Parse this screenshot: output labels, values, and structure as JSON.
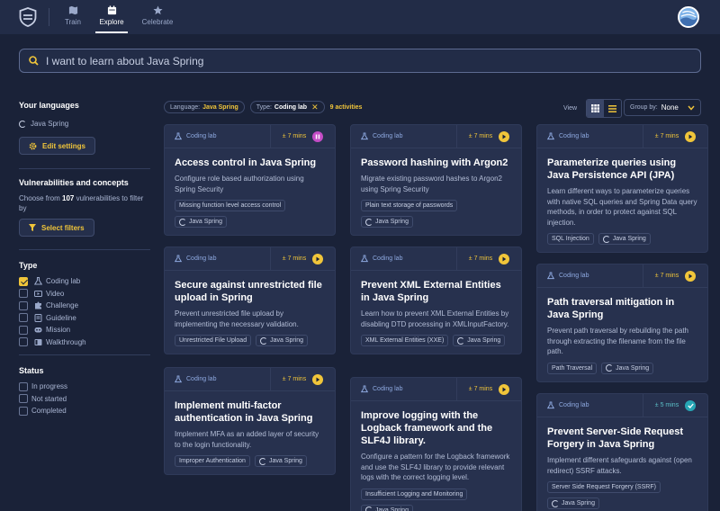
{
  "nav": {
    "items": [
      {
        "label": "Train",
        "icon": "map-icon"
      },
      {
        "label": "Explore",
        "icon": "calendar-icon",
        "active": true
      },
      {
        "label": "Celebrate",
        "icon": "star-icon"
      }
    ]
  },
  "search": {
    "placeholder": "I want to learn about Java Spring"
  },
  "sidebar": {
    "languages_title": "Your languages",
    "language": "Java Spring",
    "edit_settings": "Edit settings",
    "vuln_title": "Vulnerabilities and concepts",
    "vuln_text_before": "Choose from ",
    "vuln_count": "107",
    "vuln_text_after": " vulnerabilities to filter by",
    "select_filters": "Select filters",
    "type_title": "Type",
    "types": [
      {
        "label": "Coding lab",
        "checked": true,
        "icon": "flask-icon"
      },
      {
        "label": "Video",
        "checked": false,
        "icon": "video-icon"
      },
      {
        "label": "Challenge",
        "checked": false,
        "icon": "puzzle-icon"
      },
      {
        "label": "Guideline",
        "checked": false,
        "icon": "guideline-icon"
      },
      {
        "label": "Mission",
        "checked": false,
        "icon": "mission-icon"
      },
      {
        "label": "Walkthrough",
        "checked": false,
        "icon": "walkthrough-icon"
      }
    ],
    "status_title": "Status",
    "statuses": [
      {
        "label": "In progress",
        "checked": false
      },
      {
        "label": "Not started",
        "checked": false
      },
      {
        "label": "Completed",
        "checked": false
      }
    ]
  },
  "filters": {
    "language_prefix": "Language:",
    "language_value": "Java Spring",
    "type_prefix": "Type:",
    "type_value": "Coding lab",
    "activity_count": "9 activities"
  },
  "view": {
    "label": "View",
    "group_by_label": "Group by:",
    "group_by_value": "None"
  },
  "cards": [
    {
      "type": "Coding lab",
      "duration": "± 7 mins",
      "status": "pause",
      "title": "Access control in Java Spring",
      "desc": "Configure role based authorization using Spring Security",
      "tags": [
        "Missing function level access control",
        "Java Spring"
      ]
    },
    {
      "type": "Coding lab",
      "duration": "± 7 mins",
      "status": "play",
      "title": "Secure against unrestricted file upload in Spring",
      "desc": "Prevent unrestricted file upload by implementing the necessary validation.",
      "tags": [
        "Unrestricted File Upload",
        "Java Spring"
      ]
    },
    {
      "type": "Coding lab",
      "duration": "± 7 mins",
      "status": "play",
      "title": "Implement multi-factor authentication in Java Spring",
      "desc": "Implement MFA as an added layer of security to the login functionality.",
      "tags": [
        "Improper Authentication",
        "Java Spring"
      ]
    },
    {
      "type": "Coding lab",
      "duration": "± 7 mins",
      "status": "play",
      "title": "Password hashing with Argon2",
      "desc": "Migrate existing password hashes to Argon2 using Spring Security",
      "tags": [
        "Plain text storage of passwords",
        "Java Spring"
      ]
    },
    {
      "type": "Coding lab",
      "duration": "± 7 mins",
      "status": "play",
      "title": "Prevent XML External Entities in Java Spring",
      "desc": "Learn how to prevent XML External Entities by disabling DTD processing in XMLInputFactory.",
      "tags": [
        "XML External Entities (XXE)",
        "Java Spring"
      ]
    },
    {
      "type": "Coding lab",
      "duration": "± 7 mins",
      "status": "play",
      "title": "Improve logging with the Logback framework and the SLF4J library.",
      "desc": "Configure a pattern for the Logback framework and use the SLF4J library to provide relevant logs with the correct logging level.",
      "tags": [
        "Insufficient Logging and Monitoring",
        "Java Spring"
      ]
    },
    {
      "type": "Coding lab",
      "duration": "± 7 mins",
      "status": "play",
      "title": "Parameterize queries using Java Persistence API (JPA)",
      "desc": "Learn different ways to parameterize queries with native SQL queries and Spring Data query methods, in order to protect against SQL injection.",
      "tags": [
        "SQL Injection",
        "Java Spring"
      ]
    },
    {
      "type": "Coding lab",
      "duration": "± 7 mins",
      "status": "play",
      "title": "Path traversal mitigation in Java Spring",
      "desc": "Prevent path traversal by rebuilding the path through extracting the filename from the file path.",
      "tags": [
        "Path Traversal",
        "Java Spring"
      ]
    },
    {
      "type": "Coding lab",
      "duration": "± 5 mins",
      "status": "done",
      "title": "Prevent Server-Side Request Forgery in Java Spring",
      "desc": "Implement different safeguards against (open redirect) SSRF attacks.",
      "tags": [
        "Server Side Request Forgery (SSRF)",
        "Java Spring"
      ]
    }
  ],
  "colors": {
    "accent": "#f0c53a",
    "background": "#1a2238",
    "card": "#27314e",
    "pause": "#c44dc6",
    "done": "#27a6b5"
  }
}
